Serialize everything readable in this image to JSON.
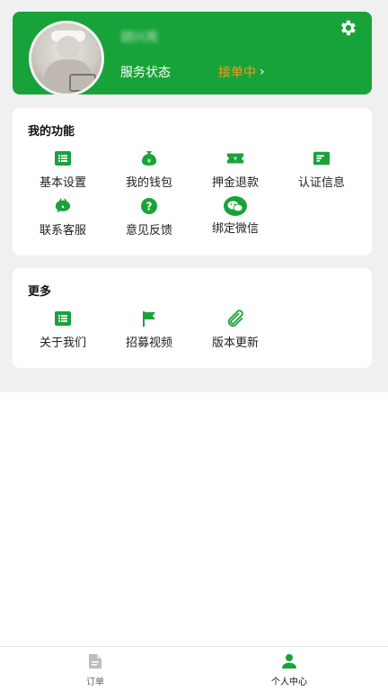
{
  "profile": {
    "username": "胡兴亮",
    "status_label": "服务状态",
    "status_value": "接单中",
    "status_chevron": "›",
    "avatar_icon": "user-photo",
    "settings_icon": "gear-icon"
  },
  "colors": {
    "brand_green": "#18a33a",
    "status_orange": "#f29a1d",
    "background_gray": "#f0f0f0"
  },
  "functions": {
    "title": "我的功能",
    "items": [
      {
        "label": "基本设置",
        "icon": "list-icon"
      },
      {
        "label": "我的钱包",
        "icon": "money-bag-icon"
      },
      {
        "label": "押金退款",
        "icon": "ticket-icon"
      },
      {
        "label": "认证信息",
        "icon": "id-card-icon"
      },
      {
        "label": "联系客服",
        "icon": "chat-bubble-icon"
      },
      {
        "label": "意见反馈",
        "icon": "question-icon"
      },
      {
        "label": "绑定微信",
        "icon": "wechat-icon"
      }
    ]
  },
  "more": {
    "title": "更多",
    "items": [
      {
        "label": "关于我们",
        "icon": "list-icon"
      },
      {
        "label": "招募视频",
        "icon": "flag-icon"
      },
      {
        "label": "版本更新",
        "icon": "paperclip-icon"
      }
    ]
  },
  "tabbar": {
    "items": [
      {
        "label": "订单",
        "icon": "document-icon",
        "active": false
      },
      {
        "label": "个人中心",
        "icon": "person-icon",
        "active": true
      }
    ]
  }
}
